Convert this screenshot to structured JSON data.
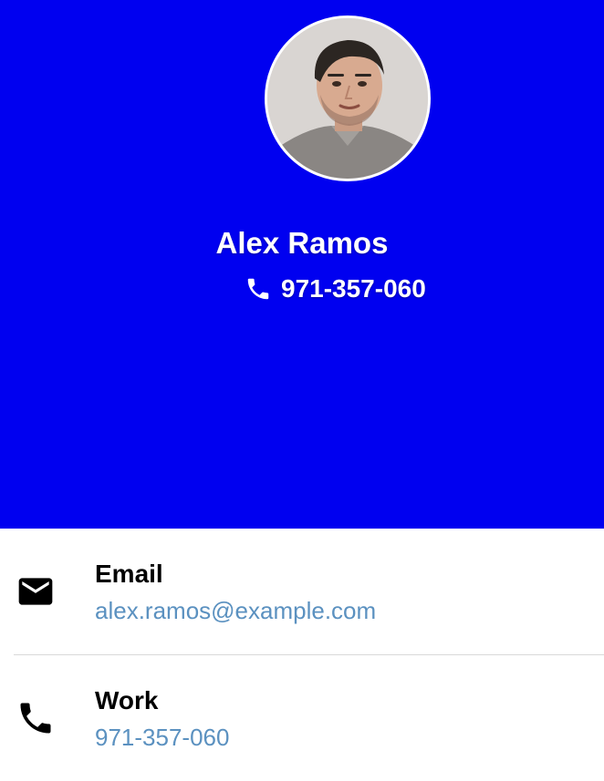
{
  "profile": {
    "name": "Alex Ramos",
    "phone": "971-357-060"
  },
  "contacts": [
    {
      "label": "Email",
      "value": "alex.ramos@example.com",
      "icon": "mail-icon"
    },
    {
      "label": "Work",
      "value": "971-357-060",
      "icon": "phone-icon"
    }
  ],
  "colors": {
    "header_bg": "#0000f0",
    "link": "#5b91c0",
    "divider": "#d9d9d9"
  }
}
